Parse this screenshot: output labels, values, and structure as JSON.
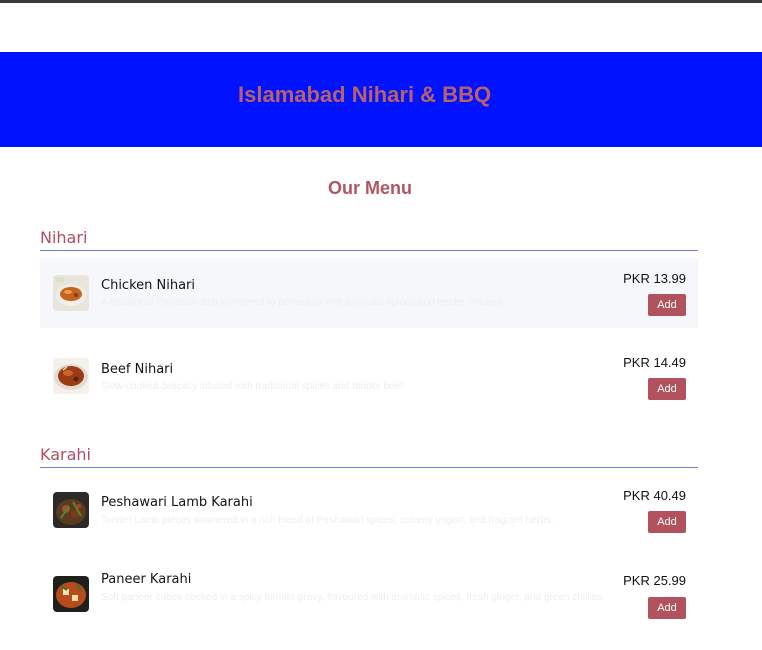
{
  "restaurant": {
    "name": "Islamabad Nihari & BBQ"
  },
  "menu": {
    "heading": "Our Menu",
    "add_label": "Add",
    "sections": [
      {
        "title": "Nihari",
        "items": [
          {
            "name": "Chicken Nihari",
            "description": "A traditional Pakistani dish simmered to perfection with aromatic spices and tender chicken.",
            "price": "PKR 13.99",
            "image": "chicken-nihari-photo"
          },
          {
            "name": "Beef Nihari",
            "description": "Slow-cooked delicacy infused with traditional spices and tender beef.",
            "price": "PKR 14.49",
            "image": "beef-nihari-photo"
          }
        ]
      },
      {
        "title": "Karahi",
        "items": [
          {
            "name": "Peshawari Lamb Karahi",
            "description": "Tender Lamb pieces simmered in a rich blend of Peshawari spices, creamy yogurt, and fragrant herbs.",
            "price": "PKR 40.49",
            "image": "lamb-karahi-photo"
          },
          {
            "name": "Paneer Karahi",
            "description": "Soft paneer cubes cooked in a spicy tomato gravy, flavoured with aromatic spices, fresh ginger, and green chillies.",
            "price": "PKR 25.99",
            "image": "paneer-karahi-photo"
          }
        ]
      }
    ]
  }
}
